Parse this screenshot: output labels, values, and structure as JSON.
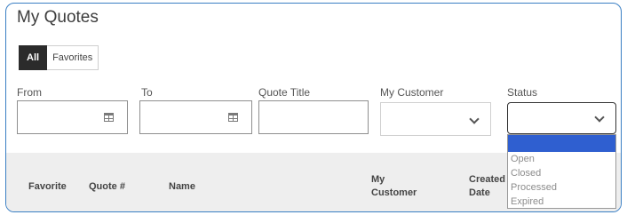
{
  "page": {
    "title": "My Quotes"
  },
  "tabs": [
    {
      "label": "All",
      "active": true
    },
    {
      "label": "Favorites",
      "active": false
    }
  ],
  "filters": {
    "from": {
      "label": "From",
      "value": "",
      "icon": "calendar-icon"
    },
    "to": {
      "label": "To",
      "value": "",
      "icon": "calendar-icon"
    },
    "quote_title": {
      "label": "Quote Title",
      "value": ""
    },
    "my_customer": {
      "label": "My Customer",
      "value": "",
      "icon": "chevron-down-icon"
    },
    "status": {
      "label": "Status",
      "value": "",
      "icon": "chevron-down-icon",
      "options": [
        "",
        "Open",
        "Closed",
        "Processed",
        "Expired"
      ],
      "highlighted_index": 0
    }
  },
  "table": {
    "headers": {
      "favorite": "Favorite",
      "quote_no": "Quote #",
      "name": "Name",
      "my_customer_l1": "My",
      "my_customer_l2": "Customer",
      "created_l1": "Created",
      "created_l2": "Date"
    }
  },
  "colors": {
    "panel_border": "#3a7fc4",
    "active_tab": "#2b2b2b",
    "dropdown_highlight": "#2f5fd0",
    "table_header_bg": "#eeeeee"
  }
}
